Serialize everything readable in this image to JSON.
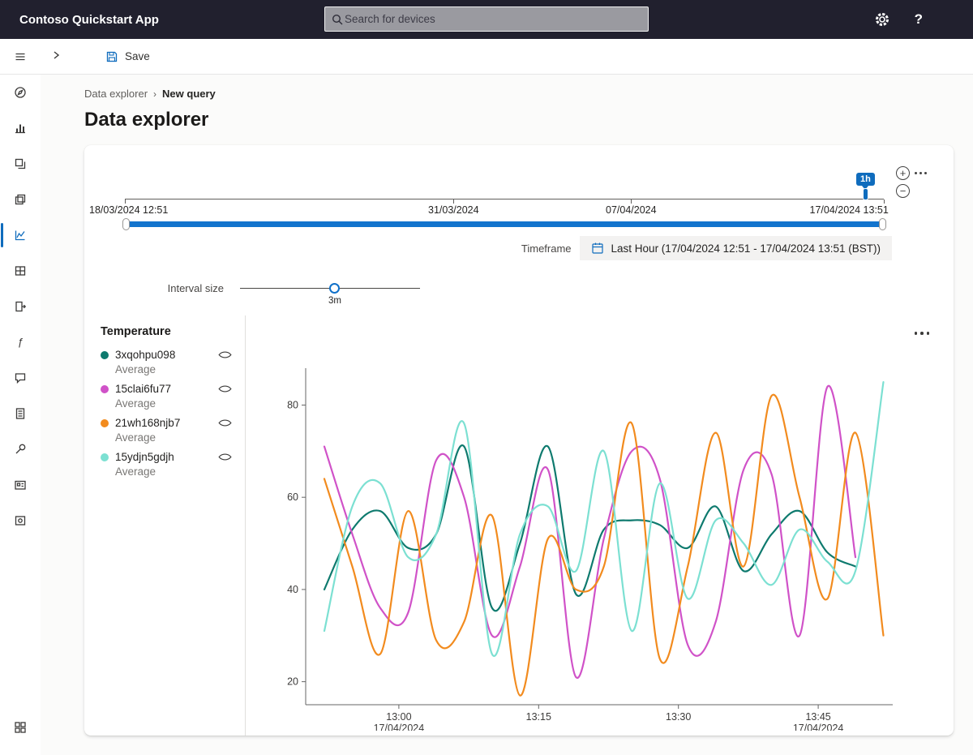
{
  "topbar": {
    "app_title": "Contoso Quickstart App",
    "search_placeholder": "Search for devices"
  },
  "commandbar": {
    "save_label": "Save"
  },
  "breadcrumb": {
    "root": "Data explorer",
    "separator": "›",
    "current": "New query"
  },
  "page": {
    "title": "Data explorer"
  },
  "controls": {
    "zoom_in": "+",
    "zoom_out": "−"
  },
  "timeline": {
    "ticks": [
      "18/03/2024 12:51",
      "31/03/2024",
      "07/04/2024",
      "17/04/2024 13:51"
    ],
    "zoom_flag": "1h"
  },
  "timeframe": {
    "label": "Timeframe",
    "value": "Last Hour (17/04/2024 12:51 - 17/04/2024 13:51 (BST))"
  },
  "interval": {
    "label": "Interval size",
    "value": "3m"
  },
  "legend": {
    "title": "Temperature"
  },
  "colors": {
    "accent": "#0f6cbd",
    "range_bar": "#1374cd",
    "topbar_bg": "#21202e"
  },
  "sidebar": {
    "items": [
      "menu",
      "dashboard",
      "analytics",
      "device-templates",
      "device-groups",
      "data-explorer",
      "jobs",
      "data-export",
      "rules",
      "deployment-manifests",
      "audit-logs",
      "permissions",
      "application",
      "customization",
      "my-apps"
    ],
    "active": "data-explorer"
  },
  "chart_data": {
    "type": "line",
    "title": "Temperature",
    "y_ticks": [
      20,
      40,
      60,
      80
    ],
    "ylim": [
      15,
      88
    ],
    "x_domain_minutes": [
      -2,
      61
    ],
    "x_start_time": "12:52",
    "interval_minutes": 3,
    "grid": false,
    "legend_position": "left",
    "x_ticks": [
      {
        "minute": 8,
        "label": "13:00",
        "sub": "17/04/2024"
      },
      {
        "minute": 23,
        "label": "13:15",
        "sub": ""
      },
      {
        "minute": 38,
        "label": "13:30",
        "sub": ""
      },
      {
        "minute": 53,
        "label": "13:45",
        "sub": "17/04/2024"
      }
    ],
    "series": [
      {
        "name": "3xqohpu098",
        "aggregation": "Average",
        "color": "#0e7a6e",
        "values": [
          40,
          53,
          57,
          49,
          52,
          71,
          36,
          50,
          71,
          39,
          53,
          55,
          54,
          49,
          58,
          44,
          52,
          57,
          48,
          45,
          null
        ]
      },
      {
        "name": "15clai6fu77",
        "aggregation": "Average",
        "color": "#d052c8",
        "values": [
          71,
          52,
          36,
          35,
          68,
          60,
          30,
          45,
          66,
          21,
          51,
          70,
          64,
          28,
          33,
          66,
          65,
          30,
          84,
          47,
          null
        ]
      },
      {
        "name": "21wh168njb7",
        "aggregation": "Average",
        "color": "#f28b1e",
        "values": [
          64,
          45,
          26,
          57,
          29,
          33,
          56,
          17,
          51,
          40,
          45,
          76,
          25,
          45,
          74,
          45,
          82,
          60,
          38,
          74,
          30
        ]
      },
      {
        "name": "15ydjn5gdjh",
        "aggregation": "Average",
        "color": "#7ce0d2",
        "values": [
          31,
          58,
          63,
          47,
          52,
          76,
          26,
          52,
          58,
          44,
          70,
          31,
          63,
          38,
          55,
          50,
          41,
          53,
          46,
          44,
          85
        ]
      }
    ]
  }
}
